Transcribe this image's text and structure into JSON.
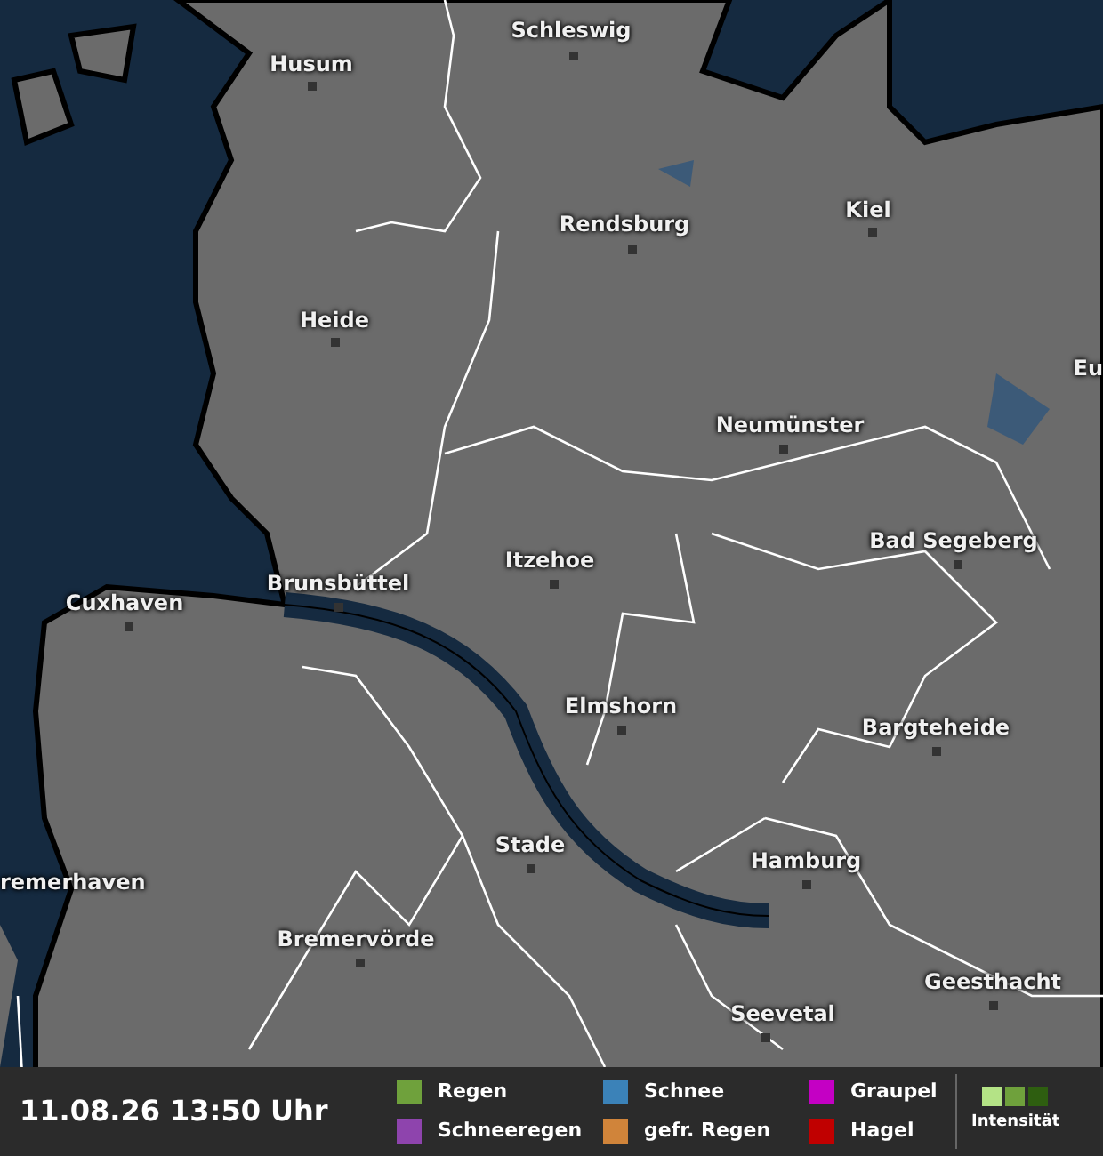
{
  "cities": [
    {
      "name": "Schleswig"
    },
    {
      "name": "Husum"
    },
    {
      "name": "Kiel"
    },
    {
      "name": "Rendsburg"
    },
    {
      "name": "Heide"
    },
    {
      "name": "Eu"
    },
    {
      "name": "Neumünster"
    },
    {
      "name": "Bad Segeberg"
    },
    {
      "name": "Itzehoe"
    },
    {
      "name": "Brunsbüttel"
    },
    {
      "name": "Cuxhaven"
    },
    {
      "name": "Elmshorn"
    },
    {
      "name": "Bargteheide"
    },
    {
      "name": "Stade"
    },
    {
      "name": "Hamburg"
    },
    {
      "name": "remerhaven"
    },
    {
      "name": "Bremervörde"
    },
    {
      "name": "Geesthacht"
    },
    {
      "name": "Seevetal"
    }
  ],
  "status_bar": {
    "timestamp": "11.08.26 13:50 Uhr",
    "legend": [
      {
        "label": "Regen",
        "color": "#6fa13c"
      },
      {
        "label": "Schneeregen",
        "color": "#8e44ad"
      },
      {
        "label": "Schnee",
        "color": "#3b82b8"
      },
      {
        "label": "gefr. Regen",
        "color": "#d0843a"
      },
      {
        "label": "Graupel",
        "color": "#c400c4"
      },
      {
        "label": "Hagel",
        "color": "#c00000"
      }
    ],
    "intensity": {
      "label": "Intensität",
      "swatches": [
        {
          "color": "#b4e386"
        },
        {
          "color": "#6fa13c"
        },
        {
          "color": "#2e5e10"
        }
      ]
    }
  }
}
